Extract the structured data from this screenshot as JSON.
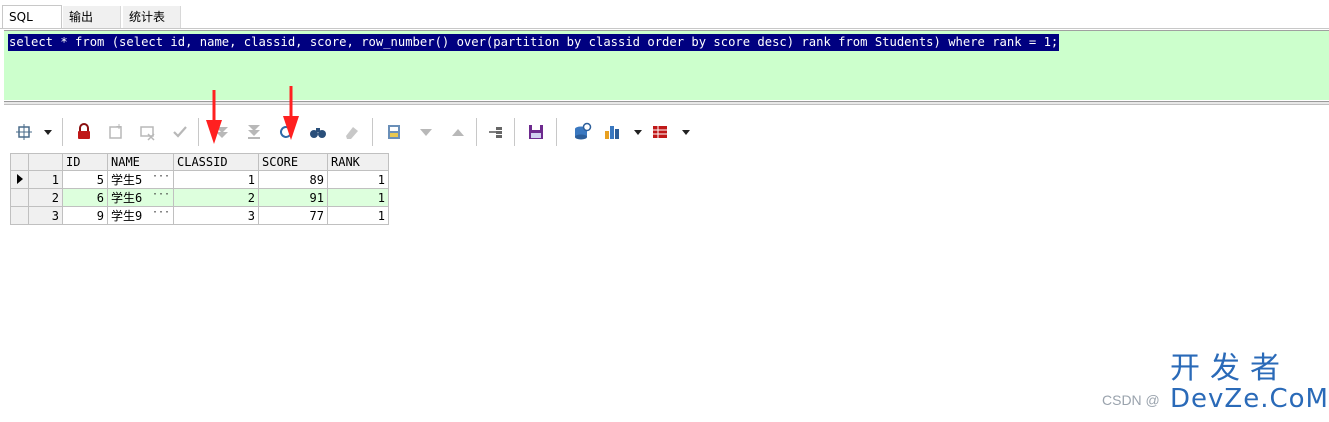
{
  "tabs": [
    {
      "label": "SQL",
      "active": true
    },
    {
      "label": "输出",
      "active": false
    },
    {
      "label": "统计表",
      "active": false
    }
  ],
  "editor": {
    "background": "#ccffcc",
    "selection_color": "#000080",
    "sql": "select * from (select id, name, classid, score, row_number() over(partition by classid order by score desc) rank from Students) where rank = 1;"
  },
  "toolbar": {
    "icons": [
      "grid-options-icon",
      "dropdown-arrow-icon",
      "lock-icon",
      "new-record-icon",
      "delete-record-icon",
      "post-changes-icon",
      "fetch-next-icon",
      "fetch-last-icon",
      "refresh-icon",
      "find-icon",
      "clear-icon",
      "save-query-icon",
      "sort-desc-icon",
      "sort-asc-icon",
      "link-icon",
      "save-icon",
      "export-icon",
      "chart-icon",
      "dropdown-arrow-icon",
      "table-icon",
      "dropdown-arrow-icon"
    ]
  },
  "annotation_color": "#ff2020",
  "grid": {
    "columns": [
      "ID",
      "NAME",
      "CLASSID",
      "SCORE",
      "RANK"
    ],
    "rows": [
      {
        "num": "1",
        "id": "5",
        "name": "学生5",
        "classid": "1",
        "score": "89",
        "rank": "1",
        "current": true
      },
      {
        "num": "2",
        "id": "6",
        "name": "学生6",
        "classid": "2",
        "score": "91",
        "rank": "1",
        "current": false
      },
      {
        "num": "3",
        "id": "9",
        "name": "学生9",
        "classid": "3",
        "score": "77",
        "rank": "1",
        "current": false
      }
    ],
    "ellipsis": "···",
    "row_highlight": "#ddffdd"
  },
  "watermark": {
    "csdn": "CSDN @",
    "logo_top": "开发者",
    "logo_bottom": "DevZe.CoM"
  }
}
